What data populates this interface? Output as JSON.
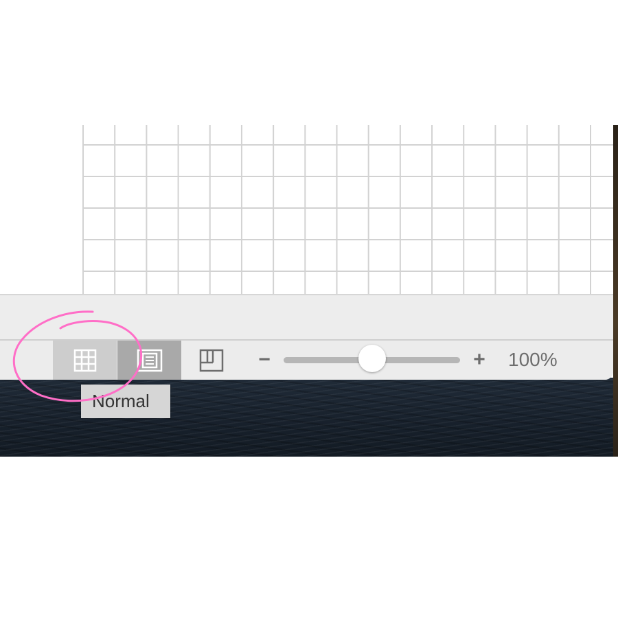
{
  "status_bar": {
    "view_buttons": [
      {
        "name": "normal",
        "icon": "normal-view-icon",
        "selected": true
      },
      {
        "name": "page-layout",
        "icon": "page-layout-view-icon",
        "selected": false
      },
      {
        "name": "page-break-preview",
        "icon": "page-break-preview-icon",
        "selected": false
      }
    ],
    "zoom": {
      "minus_label": "−",
      "plus_label": "+",
      "value_label": "100%",
      "slider_fraction": 0.5
    }
  },
  "tooltip": {
    "text": "Normal"
  },
  "colors": {
    "annotation": "#ff6ec7",
    "gridline": "#d2d2d2",
    "window_bg": "#ececec"
  }
}
